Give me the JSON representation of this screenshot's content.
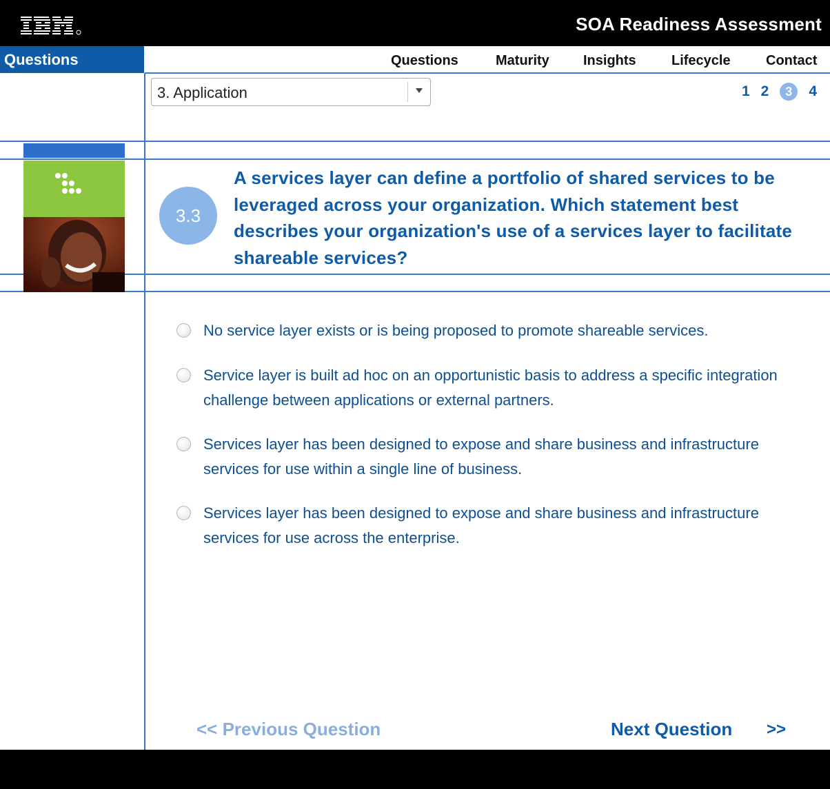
{
  "header": {
    "logo": "IBM",
    "title": "SOA Readiness Assessment"
  },
  "sidebar": {
    "section_label": "Questions"
  },
  "nav": {
    "items": [
      {
        "label": "Questions",
        "active": true
      },
      {
        "label": "Maturity",
        "active": false
      },
      {
        "label": "Insights",
        "active": false
      },
      {
        "label": "Lifecycle",
        "active": false
      },
      {
        "label": "Contact",
        "active": false
      }
    ]
  },
  "section_select": {
    "value": "3. Application"
  },
  "pager": {
    "pages": [
      "1",
      "2",
      "3",
      "4"
    ],
    "current": "3"
  },
  "question": {
    "number": "3.3",
    "text": "A services layer can define a portfolio of shared services to be leveraged across your organization. Which statement best describes your organization's use of a services layer to facilitate shareable services?"
  },
  "answers": [
    {
      "label": "No service layer exists or is being proposed to promote shareable services.",
      "selected": false
    },
    {
      "label": "Service layer is built ad hoc on an opportunistic basis to address a specific integration challenge between applications or external partners.",
      "selected": false
    },
    {
      "label": "Services layer has been designed to expose and share business and infrastructure services for use within a single line of business.",
      "selected": false
    },
    {
      "label": "Services layer has been designed to expose and share business and infrastructure services for use across the enterprise.",
      "selected": false
    }
  ],
  "footer_nav": {
    "previous_label": "<< Previous Question",
    "next_label": "Next Question",
    "next_arrow": ">>"
  },
  "colors": {
    "brand_blue": "#0f5ba8",
    "accent_light_blue": "#8cb5e8",
    "green": "#8dc63f"
  }
}
